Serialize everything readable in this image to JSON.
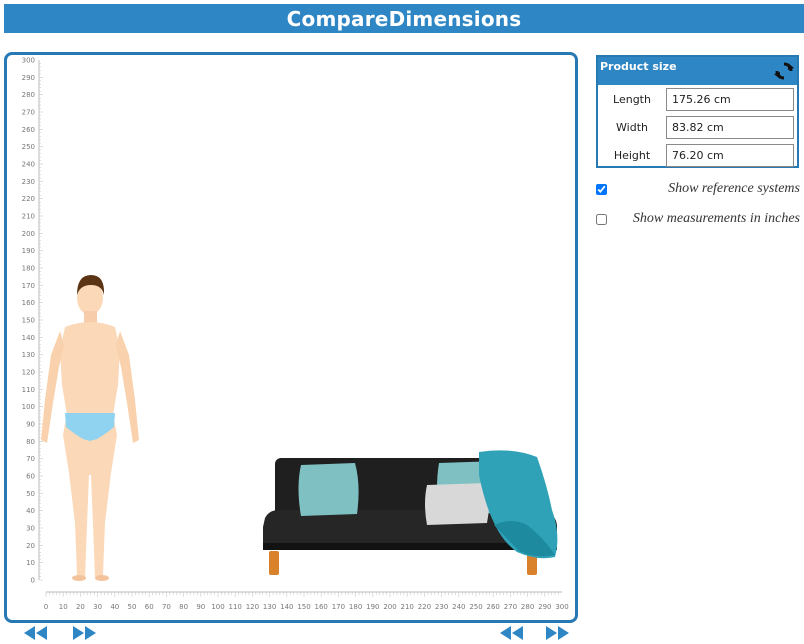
{
  "app": {
    "title": "CompareDimensions"
  },
  "ruler": {
    "y_labels": [
      "0",
      "10",
      "20",
      "30",
      "40",
      "50",
      "60",
      "70",
      "80",
      "90",
      "100",
      "110",
      "120",
      "130",
      "140",
      "150",
      "160",
      "170",
      "180",
      "190",
      "200",
      "210",
      "220",
      "230",
      "240",
      "250",
      "260",
      "270",
      "280",
      "290",
      "300"
    ],
    "x_labels": [
      "0",
      "10",
      "20",
      "30",
      "40",
      "50",
      "60",
      "70",
      "80",
      "90",
      "100",
      "110",
      "120",
      "130",
      "140",
      "150",
      "160",
      "170",
      "180",
      "190",
      "200",
      "210",
      "220",
      "230",
      "240",
      "250",
      "260",
      "270",
      "280",
      "290",
      "300"
    ]
  },
  "product_size": {
    "header": "Product size",
    "length_label": "Length",
    "length_value": "175.26 cm",
    "width_label": "Width",
    "width_value": "83.82 cm",
    "height_label": "Height",
    "height_value": "76.20 cm"
  },
  "options": {
    "show_reference_systems": {
      "label": "Show reference systems",
      "checked": true
    },
    "show_inches": {
      "label": "Show measurements in inches",
      "checked": false
    }
  },
  "icons": {
    "refresh": "refresh-icon",
    "prev_left": "double-arrow-left-icon",
    "next_left": "double-arrow-right-icon",
    "prev_right": "double-arrow-left-icon",
    "next_right": "double-arrow-right-icon"
  },
  "colors": {
    "accent": "#2e87c4",
    "frame": "#2779b4",
    "skin": "#fbd9b8",
    "underwear": "#8fd3f0",
    "hair": "#5a3414",
    "sofa": "#1f1f1f",
    "pillow_teal": "#7fc1c3",
    "pillow_grey": "#d8d8d8",
    "blanket": "#2fa2b8",
    "legs": "#d9822b",
    "ruler_text": "#777777"
  }
}
